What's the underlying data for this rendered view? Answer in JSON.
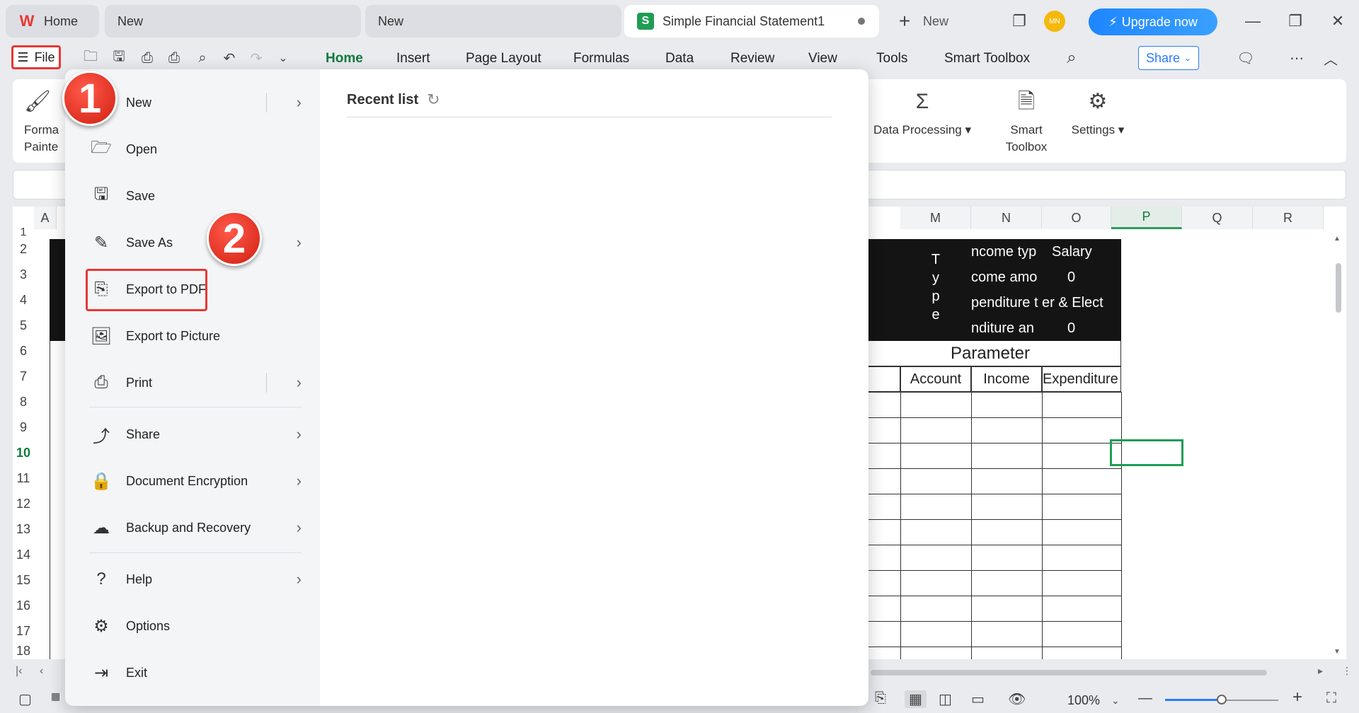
{
  "tabs": [
    {
      "label": "Home"
    },
    {
      "label": "New"
    },
    {
      "label": "New"
    },
    {
      "label": "Simple Financial Statement1"
    }
  ],
  "tabbar": {
    "new_label": "New",
    "avatar_initials": "MN",
    "upgrade_label": "Upgrade now"
  },
  "menubar": {
    "file_label": "File",
    "items": [
      "Home",
      "Insert",
      "Page Layout",
      "Formulas",
      "Data",
      "Review",
      "View",
      "Tools",
      "Smart Toolbox"
    ],
    "share_label": "Share"
  },
  "ribbon": {
    "format_painter": [
      "Forma",
      "Painte"
    ],
    "data_processing": "Data Processing",
    "smart_toolbox": [
      "Smart",
      "Toolbox"
    ],
    "settings": "Settings"
  },
  "sheet": {
    "col_A": "A",
    "columns": [
      "M",
      "N",
      "O",
      "P",
      "Q",
      "R"
    ],
    "rows": [
      "1",
      "2",
      "3",
      "4",
      "5",
      "6",
      "7",
      "8",
      "9",
      "10",
      "11",
      "12",
      "13",
      "14",
      "15",
      "16",
      "17",
      "18"
    ],
    "type_vertical": [
      "T",
      "y",
      "p",
      "e"
    ],
    "zeros": [
      "0",
      "0",
      "0"
    ],
    "dark_rows": [
      {
        "label": "ncome typ",
        "value": "Salary"
      },
      {
        "label": "come amo",
        "value": "0"
      },
      {
        "label": "penditure t",
        "value": "er & Elect"
      },
      {
        "label": "nditure an",
        "value": "0"
      }
    ],
    "parameter": "Parameter",
    "headers": [
      "Account",
      "Income",
      "Expenditure"
    ]
  },
  "file_menu": {
    "items": [
      {
        "label": "New",
        "has_arrow": true
      },
      {
        "label": "Open",
        "has_arrow": false
      },
      {
        "label": "Save",
        "has_arrow": false
      },
      {
        "label": "Save As",
        "has_arrow": true
      },
      {
        "label": "Export to PDF",
        "has_arrow": false
      },
      {
        "label": "Export to Picture",
        "has_arrow": false
      },
      {
        "label": "Print",
        "has_arrow": true
      },
      {
        "label": "Share",
        "has_arrow": true
      },
      {
        "label": "Document Encryption",
        "has_arrow": true
      },
      {
        "label": "Backup and Recovery",
        "has_arrow": true
      },
      {
        "label": "Help",
        "has_arrow": true
      },
      {
        "label": "Options",
        "has_arrow": false
      },
      {
        "label": "Exit",
        "has_arrow": false
      }
    ],
    "recent_title": "Recent list"
  },
  "badges": [
    "1",
    "2"
  ],
  "status": {
    "zoom": "100%",
    "zoom_level": 0.5
  },
  "colors": {
    "accent_green": "#0f7b3f",
    "highlight_red": "#e53935",
    "upgrade_blue": "#2b7cff"
  }
}
